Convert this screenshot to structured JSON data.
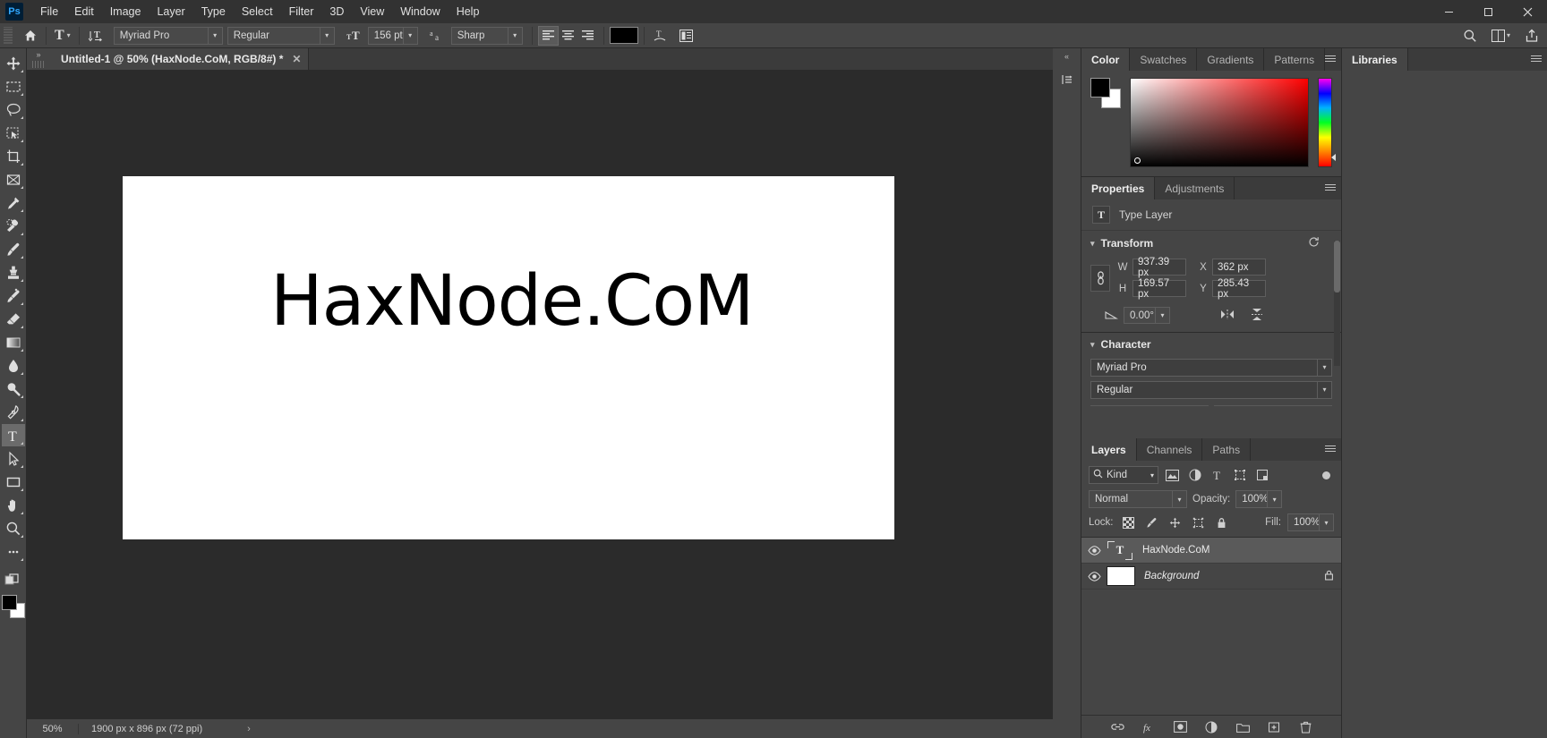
{
  "app": {
    "logo": "Ps",
    "menus": [
      "File",
      "Edit",
      "Image",
      "Layer",
      "Type",
      "Select",
      "Filter",
      "3D",
      "View",
      "Window",
      "Help"
    ],
    "window_buttons": {
      "minimize": "─",
      "maximize": "☐",
      "close": "✕"
    }
  },
  "options_bar": {
    "home_icon": "home-icon",
    "tool_preset": "T",
    "orientation_icon": "text-orientation-icon",
    "font_family": "Myriad Pro",
    "font_style": "Regular",
    "size_icon": "font-size-icon",
    "font_size": "156 pt",
    "antialias_icon": "anti-alias-icon",
    "antialias": "Sharp",
    "align_left": "align-left-icon",
    "align_center": "align-center-icon",
    "align_right": "align-right-icon",
    "color_swatch": "#000000",
    "warp_icon": "warp-text-icon",
    "panels_icon": "character-panel-icon",
    "search_icon": "search-icon",
    "arrange_icon": "arrange-documents-icon",
    "workspace_icon": "workspace-icon",
    "share_icon": "share-icon"
  },
  "toolbar": {
    "tools": [
      {
        "name": "move-tool",
        "label": "Move Tool"
      },
      {
        "name": "rectangular-marquee-tool",
        "label": "Rectangular Marquee Tool"
      },
      {
        "name": "lasso-tool",
        "label": "Lasso Tool"
      },
      {
        "name": "object-selection-tool",
        "label": "Object Selection Tool"
      },
      {
        "name": "crop-tool",
        "label": "Crop Tool"
      },
      {
        "name": "frame-tool",
        "label": "Frame Tool"
      },
      {
        "name": "eyedropper-tool",
        "label": "Eyedropper Tool"
      },
      {
        "name": "spot-healing-brush-tool",
        "label": "Spot Healing Brush Tool"
      },
      {
        "name": "brush-tool",
        "label": "Brush Tool"
      },
      {
        "name": "clone-stamp-tool",
        "label": "Clone Stamp Tool"
      },
      {
        "name": "history-brush-tool",
        "label": "History Brush Tool"
      },
      {
        "name": "eraser-tool",
        "label": "Eraser Tool"
      },
      {
        "name": "gradient-tool",
        "label": "Gradient Tool"
      },
      {
        "name": "blur-tool",
        "label": "Blur Tool"
      },
      {
        "name": "dodge-tool",
        "label": "Dodge Tool"
      },
      {
        "name": "pen-tool",
        "label": "Pen Tool"
      },
      {
        "name": "horizontal-type-tool",
        "label": "Horizontal Type Tool",
        "selected": true
      },
      {
        "name": "path-selection-tool",
        "label": "Path Selection Tool"
      },
      {
        "name": "rectangle-tool",
        "label": "Rectangle Tool"
      },
      {
        "name": "hand-tool",
        "label": "Hand Tool"
      },
      {
        "name": "zoom-tool",
        "label": "Zoom Tool"
      },
      {
        "name": "edit-toolbar-button",
        "label": "Edit Toolbar"
      }
    ],
    "foreground_color": "#000000",
    "background_color": "#ffffff"
  },
  "document": {
    "tab_title": "Untitled-1 @ 50% (HaxNode.CoM, RGB/8#) *",
    "close_glyph": "✕",
    "canvas_text": "HaxNode.CoM",
    "canvas_background": "#ffffff"
  },
  "status_bar": {
    "zoom": "50%",
    "doc_size": "1900 px x 896 px (72 ppi)",
    "arrow": "›"
  },
  "color_panel": {
    "tabs": [
      "Color",
      "Swatches",
      "Gradients",
      "Patterns"
    ],
    "active_tab": "Color",
    "foreground": "#000000",
    "background": "#ffffff"
  },
  "properties_panel": {
    "tabs": [
      "Properties",
      "Adjustments"
    ],
    "active_tab": "Properties",
    "layer_type_icon": "T",
    "layer_type_label": "Type Layer",
    "reset_icon": "reset-icon",
    "transform": {
      "title": "Transform",
      "link_icon": "link-icon",
      "w_label": "W",
      "w_value": "937.39 px",
      "h_label": "H",
      "h_value": "169.57 px",
      "x_label": "X",
      "x_value": "362 px",
      "y_label": "Y",
      "y_value": "285.43 px",
      "angle_icon": "angle-icon",
      "angle_value": "0.00°",
      "flip_horizontal_icon": "flip-horizontal-icon",
      "flip_vertical_icon": "flip-vertical-icon"
    },
    "character": {
      "title": "Character",
      "font_family": "Myriad Pro",
      "font_style": "Regular"
    }
  },
  "libraries_panel": {
    "tab": "Libraries"
  },
  "layers_panel": {
    "tabs": [
      "Layers",
      "Channels",
      "Paths"
    ],
    "active_tab": "Layers",
    "filter_kind": "Kind",
    "filter_icons": [
      "pixel-filter-icon",
      "adjustment-filter-icon",
      "type-filter-icon",
      "shape-filter-icon",
      "smart-object-filter-icon"
    ],
    "blend_mode": "Normal",
    "opacity_label": "Opacity:",
    "opacity_value": "100%",
    "lock_label": "Lock:",
    "lock_icons": [
      "lock-transparent-pixels-icon",
      "lock-image-pixels-icon",
      "lock-position-icon",
      "lock-artboard-icon",
      "lock-all-icon"
    ],
    "fill_label": "Fill:",
    "fill_value": "100%",
    "layers": [
      {
        "name": "HaxNode.CoM",
        "type": "type",
        "visible": true,
        "selected": true,
        "locked": false,
        "italic": false
      },
      {
        "name": "Background",
        "type": "background",
        "visible": true,
        "selected": false,
        "locked": true,
        "italic": true
      }
    ],
    "footer_icons": [
      "link-layers-icon",
      "layer-style-icon",
      "layer-mask-icon",
      "adjustment-layer-icon",
      "new-group-icon",
      "new-layer-icon",
      "delete-layer-icon"
    ]
  }
}
